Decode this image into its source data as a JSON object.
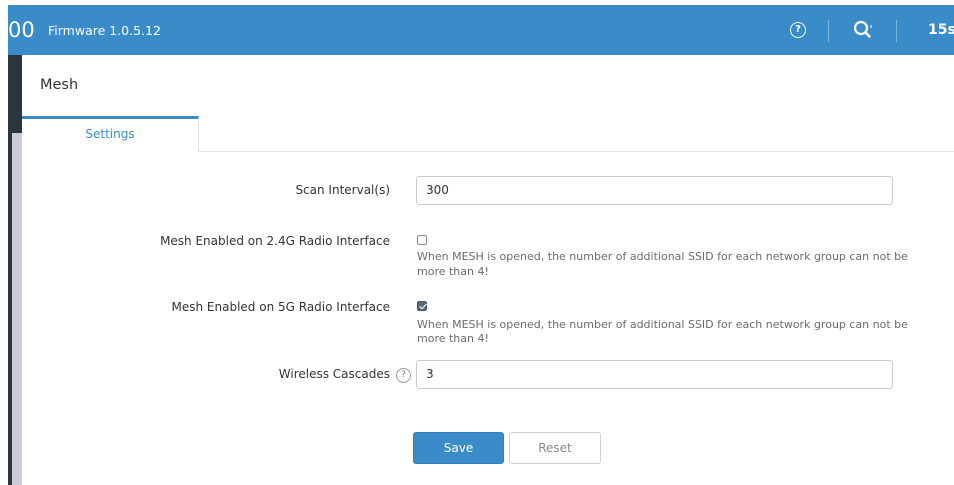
{
  "header": {
    "logo_fragment": "00",
    "firmware": "Firmware 1.0.5.12",
    "help_glyph": "?",
    "timer": "15s",
    "icons": [
      "help-circle-icon",
      "search-icon"
    ]
  },
  "panel": {
    "title": "Mesh"
  },
  "tabs": [
    {
      "label": "Settings",
      "active": true
    }
  ],
  "form": {
    "scan_interval": {
      "label": "Scan Interval(s)",
      "value": "300"
    },
    "mesh_24g": {
      "label": "Mesh Enabled on 2.4G Radio Interface",
      "checked": false,
      "note_line1": "When MESH is opened, the number of additional SSID for each network group can not be",
      "note_line2": "more than 4!"
    },
    "mesh_5g": {
      "label": "Mesh Enabled on 5G Radio Interface",
      "checked": true,
      "note_line1": "When MESH is opened, the number of additional SSID for each network group can not be",
      "note_line2": "more than 4!"
    },
    "wireless_cascades": {
      "label": "Wireless Cascades",
      "help_glyph": "?",
      "value": "3"
    }
  },
  "actions": {
    "save_label": "Save",
    "reset_label": "Reset"
  },
  "colors": {
    "accent": "#3a8cc9",
    "sidebar_dark": "#2c3440",
    "border": "#cccccc"
  }
}
